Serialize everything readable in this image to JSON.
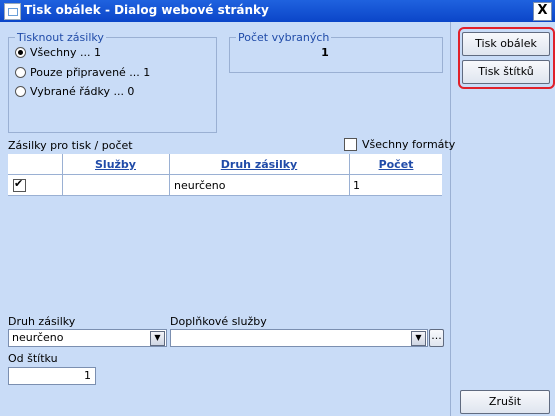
{
  "window": {
    "title": "Tisk obálek - Dialog webové stránky",
    "close_label": "X"
  },
  "tisk_group": {
    "title": "Tisknout zásilky",
    "options": [
      {
        "label": "Všechny ... 1",
        "selected": true
      },
      {
        "label": "Pouze připravené ... 1",
        "selected": false
      },
      {
        "label": "Vybrané řádky ... 0",
        "selected": false
      }
    ]
  },
  "count_group": {
    "title": "Počet vybraných",
    "value": "1"
  },
  "list": {
    "title": "Zásilky pro tisk / počet",
    "all_formats_label": "Všechny formáty",
    "all_formats_checked": false,
    "columns": [
      "Služby",
      "Druh zásilky",
      "Počet"
    ],
    "rows": [
      {
        "checked": true,
        "sluzby": "",
        "druh": "neurčeno",
        "pocet": "1"
      }
    ]
  },
  "druh_zasilky": {
    "label": "Druh zásilky",
    "value": "neurčeno"
  },
  "doplnkove": {
    "label": "Doplňkové služby",
    "value": "",
    "browse_label": "..."
  },
  "od_stitku": {
    "label": "Od štítku",
    "value": "1"
  },
  "buttons": {
    "tisk_obalek": "Tisk obálek",
    "tisk_stitku": "Tisk štítků",
    "zrusit": "Zrušit"
  },
  "colors": {
    "accent": "#204ba8",
    "highlight": "#e0212b",
    "background": "#c9dcf7"
  }
}
